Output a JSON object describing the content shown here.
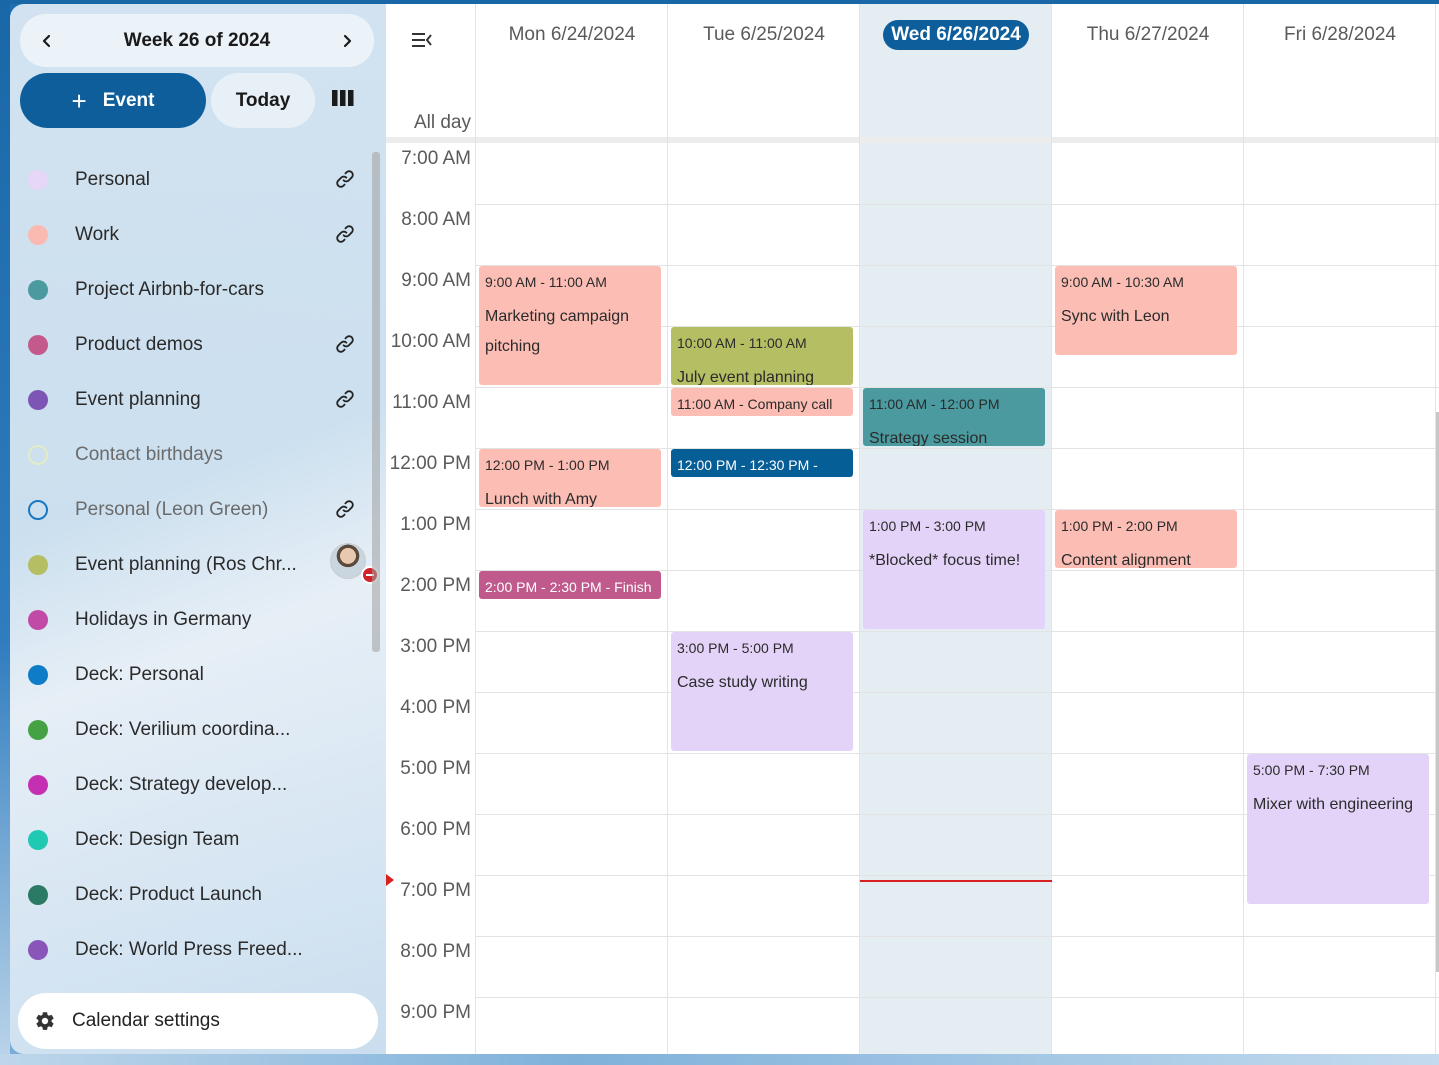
{
  "header": {
    "week_title": "Week 26 of 2024",
    "event_button": "Event",
    "today_button": "Today"
  },
  "calendars": [
    {
      "label": "Personal",
      "color": "#e6d6f8",
      "hollow": false,
      "shared": true,
      "muted": false
    },
    {
      "label": "Work",
      "color": "#fbbab1",
      "hollow": false,
      "shared": true,
      "muted": false
    },
    {
      "label": "Project Airbnb-for-cars",
      "color": "#4a9aa0",
      "hollow": false,
      "shared": false,
      "muted": false
    },
    {
      "label": "Product demos",
      "color": "#c4598b",
      "hollow": false,
      "shared": true,
      "muted": false
    },
    {
      "label": "Event planning",
      "color": "#7d55b5",
      "hollow": false,
      "shared": true,
      "muted": false
    },
    {
      "label": "Contact birthdays",
      "color": "#e3ecc4",
      "hollow": true,
      "shared": false,
      "muted": true
    },
    {
      "label": "Personal (Leon Green)",
      "color": "#1a78c2",
      "hollow": true,
      "shared": true,
      "muted": true
    },
    {
      "label": "Event planning (Ros Chr...",
      "color": "#b5be63",
      "hollow": false,
      "shared": false,
      "muted": false,
      "avatar": true
    },
    {
      "label": "Holidays in Germany",
      "color": "#c14aa6",
      "hollow": false,
      "shared": false,
      "muted": false
    },
    {
      "label": "Deck: Personal",
      "color": "#0f7cc8",
      "hollow": false,
      "shared": false,
      "muted": false
    },
    {
      "label": "Deck: Verilium coordina...",
      "color": "#44a244",
      "hollow": false,
      "shared": false,
      "muted": false
    },
    {
      "label": "Deck: Strategy develop...",
      "color": "#c530b3",
      "hollow": false,
      "shared": false,
      "muted": false
    },
    {
      "label": "Deck: Design Team",
      "color": "#1fc9b2",
      "hollow": false,
      "shared": false,
      "muted": false
    },
    {
      "label": "Deck: Product Launch",
      "color": "#2a7a65",
      "hollow": false,
      "shared": false,
      "muted": false
    },
    {
      "label": "Deck: World Press Freed...",
      "color": "#8a55b8",
      "hollow": false,
      "shared": false,
      "muted": false
    }
  ],
  "settings_label": "Calendar settings",
  "grid": {
    "all_day_label": "All day",
    "days": [
      {
        "label": "Mon 6/24/2024",
        "today": false
      },
      {
        "label": "Tue 6/25/2024",
        "today": false
      },
      {
        "label": "Wed 6/26/2024",
        "today": true
      },
      {
        "label": "Thu 6/27/2024",
        "today": false
      },
      {
        "label": "Fri 6/28/2024",
        "today": false
      }
    ],
    "hours": [
      "7:00 AM",
      "8:00 AM",
      "9:00 AM",
      "10:00 AM",
      "11:00 AM",
      "12:00 PM",
      "1:00 PM",
      "2:00 PM",
      "3:00 PM",
      "4:00 PM",
      "5:00 PM",
      "6:00 PM",
      "7:00 PM",
      "8:00 PM",
      "9:00 PM"
    ],
    "first_hour": 7,
    "current_time": "7:00 PM"
  },
  "events": [
    {
      "day": 0,
      "start": 9,
      "end": 11,
      "time": "9:00 AM - 11:00 AM",
      "title": "Marketing campaign pitching",
      "style": "salmon"
    },
    {
      "day": 0,
      "start": 12,
      "end": 13,
      "time": "12:00 PM - 1:00 PM",
      "title": "Lunch with Amy",
      "style": "salmon"
    },
    {
      "day": 0,
      "start": 14,
      "end": 14.5,
      "time": "2:00 PM - 2:30 PM - Finish",
      "title": "",
      "style": "magenta"
    },
    {
      "day": 1,
      "start": 10,
      "end": 11,
      "time": "10:00 AM - 11:00 AM",
      "title": "July event planning",
      "style": "olive"
    },
    {
      "day": 1,
      "start": 11,
      "end": 11.5,
      "time": "11:00 AM - Company call",
      "title": "",
      "style": "salmon"
    },
    {
      "day": 1,
      "start": 12,
      "end": 12.5,
      "time": "12:00 PM - 12:30 PM -",
      "title": "",
      "style": "blue"
    },
    {
      "day": 1,
      "start": 15,
      "end": 17,
      "time": "3:00 PM - 5:00 PM",
      "title": "Case study writing",
      "style": "lilac"
    },
    {
      "day": 2,
      "start": 11,
      "end": 12,
      "time": "11:00 AM - 12:00 PM",
      "title": "Strategy session",
      "style": "teal"
    },
    {
      "day": 2,
      "start": 13,
      "end": 15,
      "time": "1:00 PM - 3:00 PM",
      "title": "*Blocked* focus time!",
      "style": "lilac"
    },
    {
      "day": 3,
      "start": 9,
      "end": 10.5,
      "time": "9:00 AM - 10:30 AM",
      "title": "Sync with Leon",
      "style": "salmon"
    },
    {
      "day": 3,
      "start": 13,
      "end": 14,
      "time": "1:00 PM - 2:00 PM",
      "title": "Content alignment",
      "style": "salmon"
    },
    {
      "day": 4,
      "start": 17,
      "end": 19.5,
      "time": "5:00 PM - 7:30 PM",
      "title": "Mixer with engineering",
      "style": "lilac"
    }
  ]
}
